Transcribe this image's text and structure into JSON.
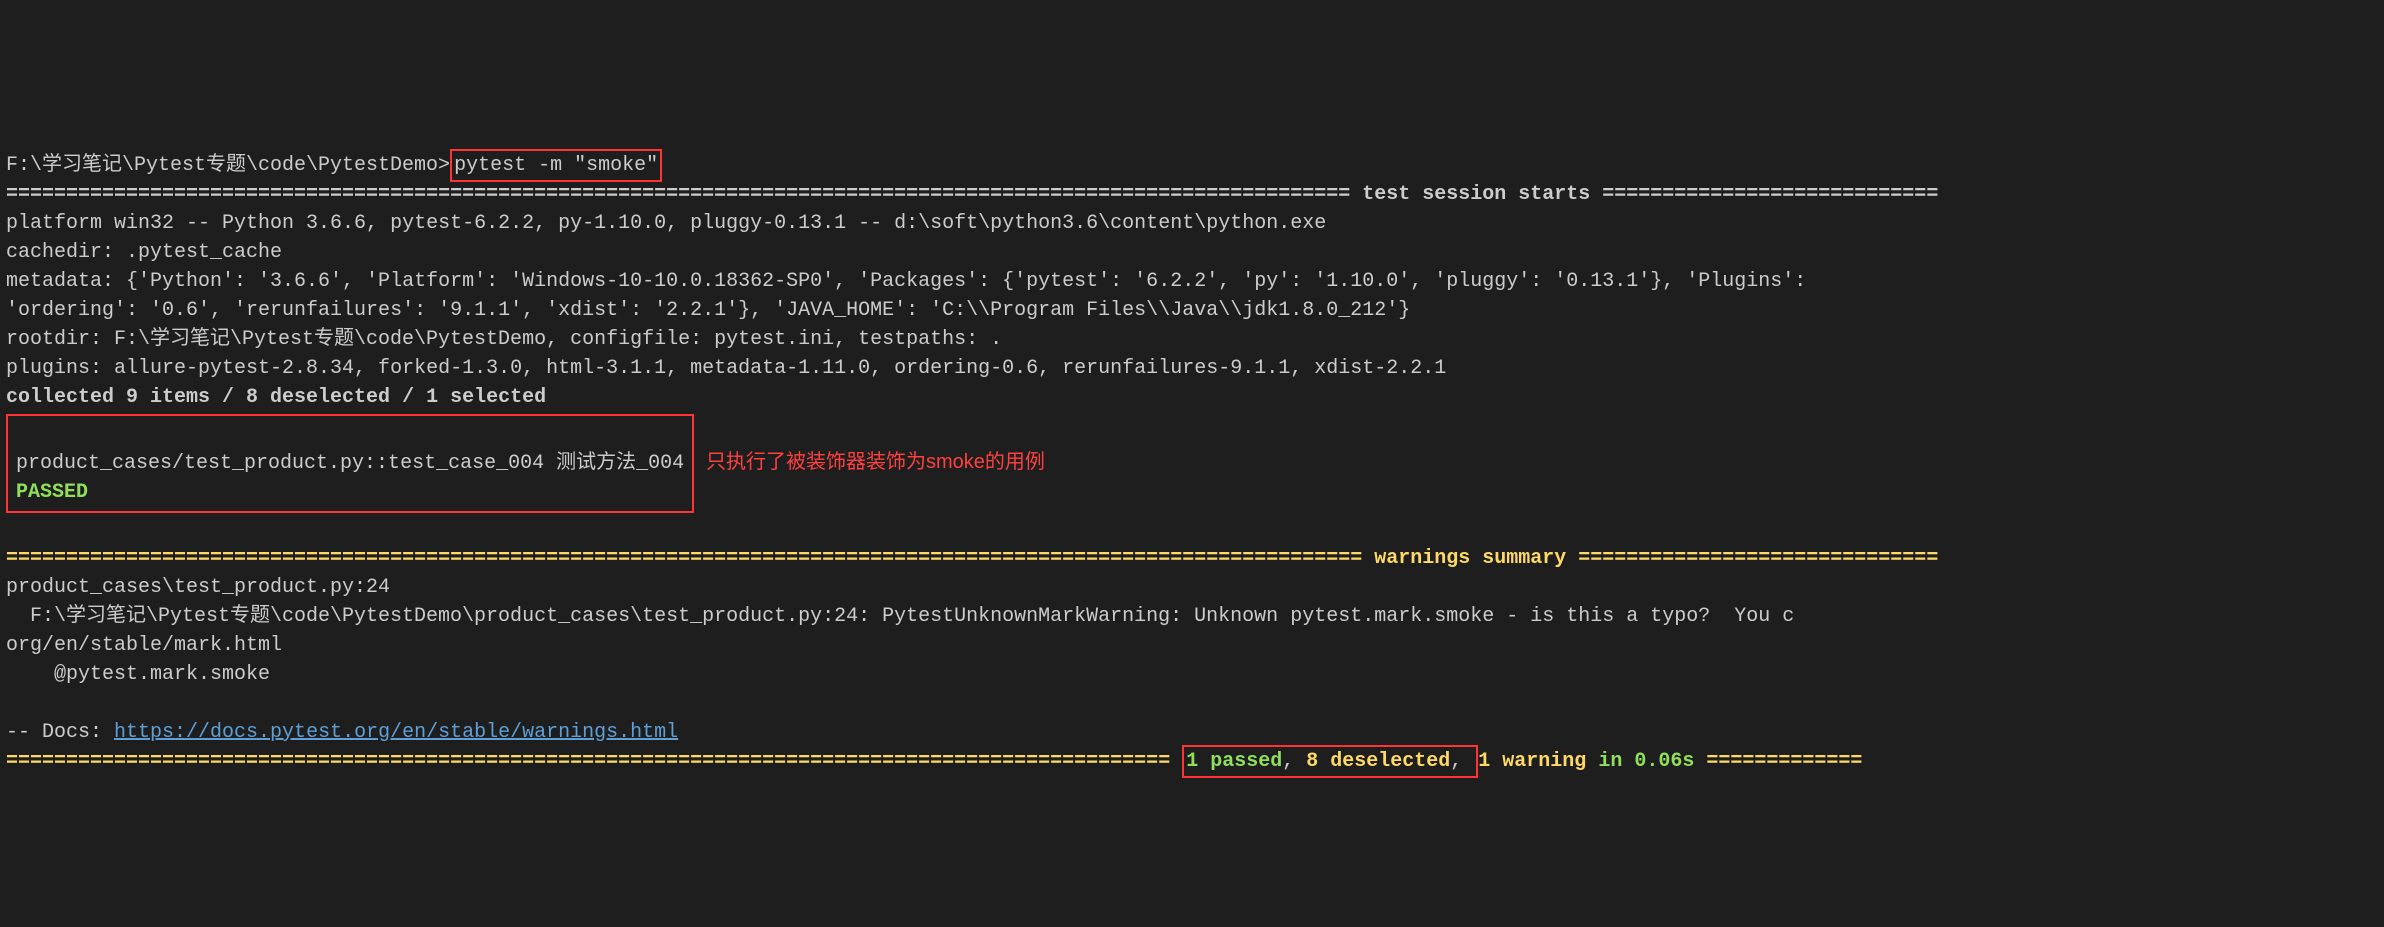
{
  "prompt": {
    "path": "F:\\学习笔记\\Pytest专题\\code\\PytestDemo>",
    "command": "pytest -m \"smoke\""
  },
  "session_header": "================================================================================================================ test session starts ============================",
  "env": {
    "platform": "platform win32 -- Python 3.6.6, pytest-6.2.2, py-1.10.0, pluggy-0.13.1 -- d:\\soft\\python3.6\\content\\python.exe",
    "cachedir": "cachedir: .pytest_cache",
    "metadata": "metadata: {'Python': '3.6.6', 'Platform': 'Windows-10-10.0.18362-SP0', 'Packages': {'pytest': '6.2.2', 'py': '1.10.0', 'pluggy': '0.13.1'}, 'Plugins':",
    "metadata2": "'ordering': '0.6', 'rerunfailures': '9.1.1', 'xdist': '2.2.1'}, 'JAVA_HOME': 'C:\\\\Program Files\\\\Java\\\\jdk1.8.0_212'}",
    "rootdir": "rootdir: F:\\学习笔记\\Pytest专题\\code\\PytestDemo, configfile: pytest.ini, testpaths: .",
    "plugins": "plugins: allure-pytest-2.8.34, forked-1.3.0, html-3.1.1, metadata-1.11.0, ordering-0.6, rerunfailures-9.1.1, xdist-2.2.1"
  },
  "collected": "collected 9 items / 8 deselected / 1 selected",
  "testcase": {
    "line": "product_cases/test_product.py::test_case_004 测试方法_004",
    "status": "PASSED"
  },
  "annotation": "只执行了被装饰器装饰为smoke的用例",
  "warnings_header": "================================================================================================================= warnings summary ==============================",
  "warning": {
    "file": "product_cases\\test_product.py:24",
    "detail": "  F:\\学习笔记\\Pytest专题\\code\\PytestDemo\\product_cases\\test_product.py:24: PytestUnknownMarkWarning: Unknown pytest.mark.smoke - is this a typo?  You c",
    "detail2": "org/en/stable/mark.html",
    "code": "    @pytest.mark.smoke"
  },
  "docs": {
    "prefix": "-- Docs: ",
    "url": "https://docs.pytest.org/en/stable/warnings.html"
  },
  "summary": {
    "prefix_eq": "================================================================================================= ",
    "passed": "1 passed",
    "sep1": ", ",
    "deselected": "8 deselected",
    "sep2": ", ",
    "warning": "1 warning",
    "time": " in 0.06s",
    "suffix_eq": " ============="
  }
}
